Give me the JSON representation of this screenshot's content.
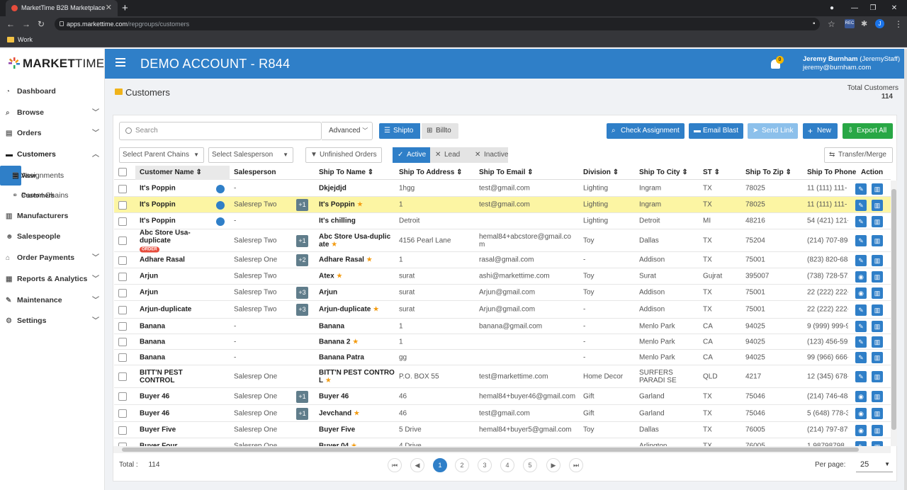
{
  "browser": {
    "tab_title": "MarketTime B2B Marketplace",
    "url_host": "apps.markettime.com",
    "url_path": "/repgroups/customers",
    "bookmark": "Work",
    "ext_rec": "REC",
    "ext_user": "J"
  },
  "brand": {
    "logo_bold": "MARKET",
    "logo_light": "TIME"
  },
  "header": {
    "account": "DEMO ACCOUNT - R844",
    "notif_count": "0",
    "user_name": "Jeremy Burnham",
    "user_handle": "(JeremyStaff)",
    "user_email": "jeremy@burnham.com"
  },
  "sidebar": {
    "items": [
      {
        "label": "Dashboard",
        "icon": "dashboard-icon"
      },
      {
        "label": "Browse",
        "icon": "search-icon"
      },
      {
        "label": "Orders",
        "icon": "document-icon"
      },
      {
        "label": "Customers",
        "icon": "id-card-icon"
      },
      {
        "label": "View Customers",
        "icon": "user-icon"
      },
      {
        "label": "Assignments",
        "icon": "list-icon"
      },
      {
        "label": "Parent Chains",
        "icon": "link-icon"
      },
      {
        "label": "Manufacturers",
        "icon": "building-icon"
      },
      {
        "label": "Salespeople",
        "icon": "people-icon"
      },
      {
        "label": "Order Payments",
        "icon": "bank-icon"
      },
      {
        "label": "Reports & Analytics",
        "icon": "chart-icon"
      },
      {
        "label": "Maintenance",
        "icon": "wrench-icon"
      },
      {
        "label": "Settings",
        "icon": "gears-icon"
      }
    ]
  },
  "page": {
    "title": "Customers",
    "total_label": "Total Customers",
    "total_value": "114"
  },
  "toolbar": {
    "search_placeholder": "Search",
    "advanced": "Advanced",
    "shipto": "Shipto",
    "billto": "Billto",
    "check_assignment": "Check Assignment",
    "email_blast": "Email Blast",
    "send_link": "Send Link",
    "new": "New",
    "export_all": "Export All",
    "parent_chains": "Select Parent Chains",
    "salesperson": "Select Salesperson",
    "unfinished": "Unfinished Orders",
    "active": "Active",
    "lead": "Lead",
    "inactive": "Inactive",
    "transfer": "Transfer/Merge"
  },
  "table": {
    "headers": [
      "Customer Name",
      "Salesperson",
      "Ship To Name",
      "Ship To Address",
      "Ship To Email",
      "Division",
      "Ship To City",
      "ST",
      "Ship To Zip",
      "Ship To Phone",
      "Action"
    ],
    "rows": [
      {
        "name": "It's Poppin",
        "msg": true,
        "order": false,
        "sales": "-",
        "extra": "",
        "shipto": "Dkjejdjd",
        "star": false,
        "addr": "1hgg",
        "email": "test@gmail.com",
        "div": "Lighting",
        "city": "Ingram",
        "st": "TX",
        "zip": "78025",
        "phone": "11 (111) 111-",
        "view": false
      },
      {
        "name": "It's Poppin",
        "msg": true,
        "order": false,
        "sales": "Salesrep Two",
        "extra": "+1",
        "shipto": "It's Poppin",
        "star": true,
        "addr": "1",
        "email": "test@gmail.com",
        "div": "Lighting",
        "city": "Ingram",
        "st": "TX",
        "zip": "78025",
        "phone": "11 (111) 111-",
        "view": false
      },
      {
        "name": "It's Poppin",
        "msg": true,
        "order": false,
        "sales": "-",
        "extra": "",
        "shipto": "It's chilling",
        "star": false,
        "addr": "Detroit",
        "email": "",
        "div": "Lighting",
        "city": "Detroit",
        "st": "MI",
        "zip": "48216",
        "phone": "54 (421) 121-",
        "view": false
      },
      {
        "name": "Abc Store Usa-duplicate",
        "msg": false,
        "order": true,
        "sales": "Salesrep Two",
        "extra": "+1",
        "shipto": "Abc Store Usa-duplic ate",
        "star": true,
        "addr": "4156 Pearl Lane",
        "email": "hemal84+abcstore@gmail.co m",
        "div": "Toy",
        "city": "Dallas",
        "st": "TX",
        "zip": "75204",
        "phone": "(214) 707-898",
        "view": false
      },
      {
        "name": "Adhare Rasal",
        "msg": false,
        "order": false,
        "sales": "Salesrep One",
        "extra": "+2",
        "shipto": "Adhare Rasal",
        "star": true,
        "addr": "1",
        "email": "rasal@gmail.com",
        "div": "-",
        "city": "Addison",
        "st": "TX",
        "zip": "75001",
        "phone": "(823) 820-688",
        "view": false
      },
      {
        "name": "Arjun",
        "msg": false,
        "order": false,
        "sales": "Salesrep Two",
        "extra": "",
        "shipto": "Atex",
        "star": true,
        "addr": "surat",
        "email": "ashi@markettime.com",
        "div": "Toy",
        "city": "Surat",
        "st": "Gujrat",
        "zip": "395007",
        "phone": "(738) 728-572",
        "view": true
      },
      {
        "name": "Arjun",
        "msg": false,
        "order": false,
        "sales": "Salesrep Two",
        "extra": "+3",
        "shipto": "Arjun",
        "star": false,
        "addr": "surat",
        "email": "Arjun@gmail.com",
        "div": "Toy",
        "city": "Addison",
        "st": "TX",
        "zip": "75001",
        "phone": "22 (222) 222-",
        "view": true
      },
      {
        "name": "Arjun-duplicate",
        "msg": false,
        "order": false,
        "sales": "Salesrep Two",
        "extra": "+3",
        "shipto": "Arjun-duplicate",
        "star": true,
        "addr": "surat",
        "email": "Arjun@gmail.com",
        "div": "-",
        "city": "Addison",
        "st": "TX",
        "zip": "75001",
        "phone": "22 (222) 222-",
        "view": false
      },
      {
        "name": "Banana",
        "msg": false,
        "order": false,
        "sales": "-",
        "extra": "",
        "shipto": "Banana",
        "star": false,
        "addr": "1",
        "email": "banana@gmail.com",
        "div": "-",
        "city": "Menlo Park",
        "st": "CA",
        "zip": "94025",
        "phone": "9 (999) 999-9",
        "view": false
      },
      {
        "name": "Banana",
        "msg": false,
        "order": false,
        "sales": "-",
        "extra": "",
        "shipto": "Banana 2",
        "star": true,
        "addr": "1",
        "email": "",
        "div": "-",
        "city": "Menlo Park",
        "st": "CA",
        "zip": "94025",
        "phone": "(123) 456-592",
        "view": false
      },
      {
        "name": "Banana",
        "msg": false,
        "order": false,
        "sales": "-",
        "extra": "",
        "shipto": "Banana Patra",
        "star": false,
        "addr": "gg",
        "email": "",
        "div": "-",
        "city": "Menlo Park",
        "st": "CA",
        "zip": "94025",
        "phone": "99 (966) 666-",
        "view": false
      },
      {
        "name": "BITT'N PEST CONTROL",
        "msg": false,
        "order": false,
        "sales": "Salesrep One",
        "extra": "",
        "shipto": "BITT'N PEST CONTRO L",
        "star": true,
        "addr": "P.O. BOX 55",
        "email": "test@markettime.com",
        "div": "Home Decor",
        "city": "SURFERS PARADI SE",
        "st": "QLD",
        "zip": "4217",
        "phone": "12 (345) 678-",
        "view": false
      },
      {
        "name": "Buyer 46",
        "msg": false,
        "order": false,
        "sales": "Salesrep One",
        "extra": "+1",
        "shipto": "Buyer 46",
        "star": false,
        "addr": "46",
        "email": "hemal84+buyer46@gmail.com",
        "div": "Gift",
        "city": "Garland",
        "st": "TX",
        "zip": "75046",
        "phone": "(214) 746-484",
        "view": true
      },
      {
        "name": "Buyer 46",
        "msg": false,
        "order": false,
        "sales": "Salesrep One",
        "extra": "+1",
        "shipto": "Jevchand",
        "star": true,
        "addr": "46",
        "email": "test@gmail.com",
        "div": "Gift",
        "city": "Garland",
        "st": "TX",
        "zip": "75046",
        "phone": "5 (648) 778-3",
        "view": true
      },
      {
        "name": "Buyer Five",
        "msg": false,
        "order": false,
        "sales": "Salesrep One",
        "extra": "",
        "shipto": "Buyer Five",
        "star": false,
        "addr": "5 Drive",
        "email": "hemal84+buyer5@gmail.com",
        "div": "Toy",
        "city": "Dallas",
        "st": "TX",
        "zip": "76005",
        "phone": "(214) 797-879",
        "view": true
      },
      {
        "name": "Buyer Four",
        "msg": false,
        "order": false,
        "sales": "Salesrep One",
        "extra": "",
        "shipto": "Buyer 04",
        "star": true,
        "addr": "4 Drive",
        "email": "",
        "div": "",
        "city": "Arlington",
        "st": "TX",
        "zip": "76005",
        "phone": "1 98798798",
        "view": false
      }
    ]
  },
  "footer": {
    "total_label": "Total :",
    "total_value": "114",
    "pages": [
      "1",
      "2",
      "3",
      "4",
      "5"
    ],
    "per_page_label": "Per page:",
    "per_page_value": "25"
  },
  "colors": {
    "primary": "#2f7fc8",
    "highlight": "#fcf5a3",
    "export_green": "#28a745",
    "badge_gray": "#607d8b",
    "star": "#f39c12"
  }
}
